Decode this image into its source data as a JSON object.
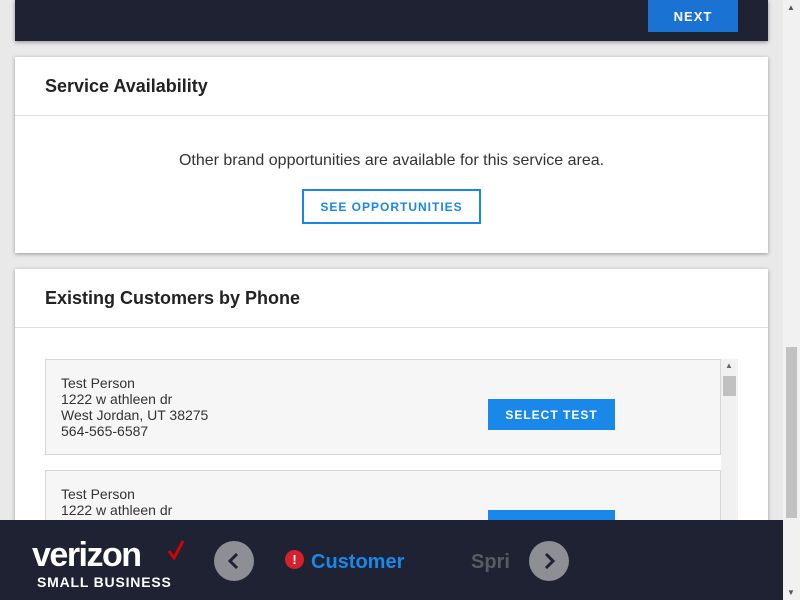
{
  "top_card": {
    "next_label": "NEXT"
  },
  "service_availability": {
    "title": "Service Availability",
    "message": "Other brand opportunities are available for this service area.",
    "button_label": "SEE OPPORTUNITIES"
  },
  "existing_customers": {
    "title": "Existing Customers by Phone",
    "customers": [
      {
        "name": "Test Person",
        "street": "1222 w athleen dr",
        "city_state_zip": "West Jordan, UT 38275",
        "phone": "564-565-6587",
        "button_label": "SELECT TEST"
      },
      {
        "name": "Test Person",
        "street": "1222 w athleen dr",
        "city_state_zip": "",
        "phone": "",
        "button_label": ""
      }
    ]
  },
  "footer": {
    "logo_text": "verizon",
    "logo_sub": "SMALL BUSINESS",
    "current_step": "Customer",
    "next_step": "Spri",
    "colors": {
      "accent": "#1a88e8",
      "alert": "#d5202e",
      "brand_check": "#cd040b",
      "dark_bg": "#1f2233"
    },
    "icons": {
      "prev": "chevron-left-icon",
      "next": "chevron-right-icon",
      "alert": "exclamation-icon"
    }
  }
}
